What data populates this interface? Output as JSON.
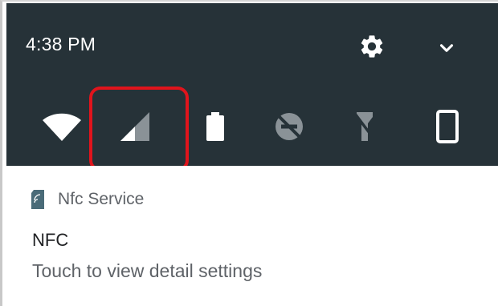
{
  "status_bar": {
    "time": "4:38 PM",
    "settings_icon": "gear-icon",
    "expand_icon": "chevron-down-icon"
  },
  "quick_settings": [
    {
      "icon": "wifi-icon",
      "state": "on"
    },
    {
      "icon": "cellular-signal-icon",
      "state": "partial",
      "highlighted": true
    },
    {
      "icon": "battery-icon",
      "state": "on"
    },
    {
      "icon": "do-not-disturb-off-icon",
      "state": "off"
    },
    {
      "icon": "flashlight-off-icon",
      "state": "off"
    },
    {
      "icon": "auto-rotate-icon",
      "state": "on"
    }
  ],
  "notification": {
    "app_icon": "nfc-icon",
    "app_name": "Nfc Service",
    "title": "NFC",
    "text": "Touch to view detail settings"
  },
  "colors": {
    "shade_background": "#263238",
    "highlight_border": "#e0141c",
    "icon_active": "#ffffff",
    "icon_inactive": "#8a9297"
  }
}
